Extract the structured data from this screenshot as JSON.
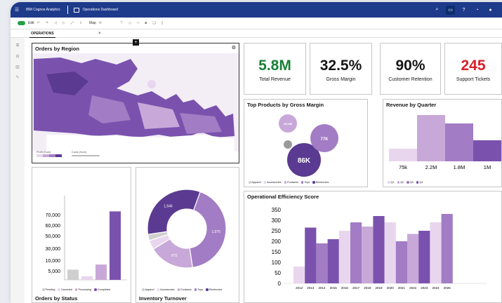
{
  "topbar": {
    "app_name": "IBM Cognos Analytics",
    "dashboard_name": "Operations Dashboard"
  },
  "toolbar": {
    "edit_label": "Edit",
    "map_label": "Map"
  },
  "tabs": [
    {
      "label": "OPERATIONS"
    }
  ],
  "colors": {
    "c1": "#e8d6ee",
    "c2": "#c8a8d8",
    "c3": "#a27cc4",
    "c4": "#7a52ae",
    "c5": "#5b3a92",
    "grey": "#cfcfcf",
    "red": "#da1e28",
    "green": "#198038"
  },
  "map": {
    "title": "Orders by Region",
    "legend_profit_label": "Profit (Sum)",
    "legend_costs_label": "Costs (Sum)"
  },
  "kpis": [
    {
      "value": "5.8M",
      "label": "Total Revenue",
      "color": "#198038"
    },
    {
      "value": "32.5%",
      "label": "Gross Margin",
      "color": "#161616"
    },
    {
      "value": "90%",
      "label": "Customer Retention",
      "color": "#161616"
    },
    {
      "value": "245",
      "label": "Support Tickets",
      "color": "#da1e28"
    }
  ],
  "legend_products": [
    "Apparel",
    "Accessories",
    "Footwear",
    "Toys",
    "Electronics"
  ],
  "legend_status": [
    "Pending",
    "Canceled",
    "Processing",
    "Completed"
  ],
  "legend_quarters": [
    "Q1",
    "Q2",
    "Q3",
    "Q4"
  ],
  "chart_data": [
    {
      "type": "scatter",
      "title": "Top Products by Gross Margin",
      "points": [
        {
          "label": "86K",
          "value": 86000
        },
        {
          "label": "77K",
          "value": 77000
        },
        {
          "label": "25,085",
          "value": 25085
        },
        {
          "label": "",
          "value": 12000
        }
      ]
    },
    {
      "type": "bar",
      "title": "Revenue by Quarter",
      "categories": [
        "",
        "",
        "",
        ""
      ],
      "tick_labels": [
        "75k",
        "2.2M",
        "1.8M",
        "1M"
      ],
      "values": [
        75000,
        2200000,
        1800000,
        1000000
      ],
      "series_colors": [
        "#e8d6ee",
        "#c8a8d8",
        "#a27cc4",
        "#7a52ae"
      ]
    },
    {
      "type": "bar",
      "title": "Orders by Status",
      "categories": [
        "Pending",
        "Canceled",
        "Processing",
        "Completed"
      ],
      "values": [
        10000,
        3500,
        15000,
        67000
      ],
      "ylim": [
        0,
        70000
      ],
      "yticks": [
        "70,000",
        "60,000",
        "50,000",
        "30,000",
        "10,000",
        "5,000"
      ]
    },
    {
      "type": "pie",
      "title": "Inventory Turnover",
      "labels": [
        "Apparel",
        "Accessories",
        "Footwear",
        "Toys",
        "Electronics"
      ],
      "slice_labels": [
        "",
        "",
        "875",
        "1,975",
        "1,546"
      ],
      "values": [
        120,
        180,
        875,
        1975,
        1546
      ]
    },
    {
      "type": "bar",
      "title": "Operational Efficiency Score",
      "categories": [
        "2012",
        "2013",
        "2014",
        "2015",
        "2016",
        "2017",
        "2018",
        "2019",
        "2020",
        "2021",
        "2022",
        "2023",
        "2024",
        "2025"
      ],
      "values": [
        80,
        265,
        190,
        210,
        250,
        290,
        270,
        320,
        290,
        200,
        235,
        250,
        290,
        330
      ],
      "ylim": [
        0,
        350
      ],
      "yticks": [
        0,
        50,
        100,
        150,
        200,
        250,
        300,
        350
      ]
    }
  ]
}
